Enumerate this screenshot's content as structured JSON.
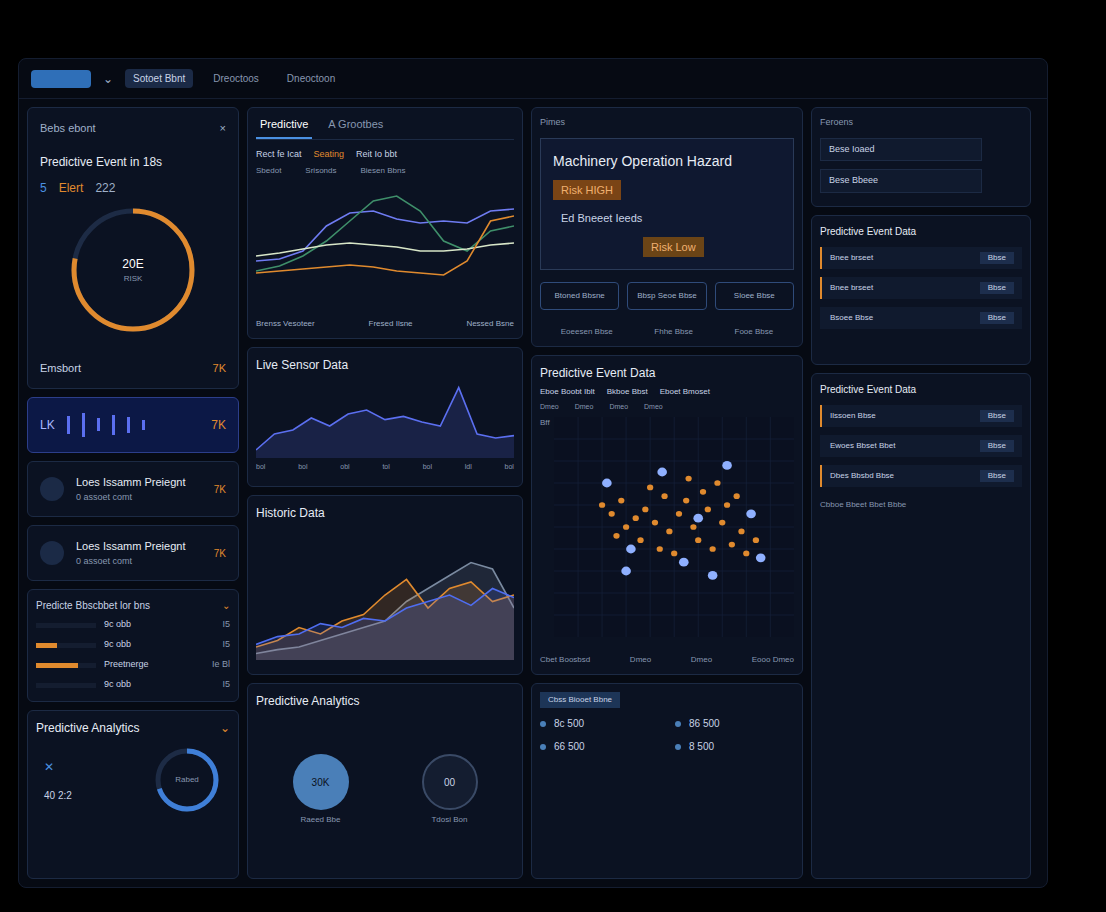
{
  "topbar": {
    "tabs": [
      {
        "label": "Sotoet Bbnt",
        "selected": true
      },
      {
        "label": "Dreoctoos",
        "selected": false
      },
      {
        "label": "Dneoctoon",
        "selected": false
      }
    ],
    "chevron": "⌄"
  },
  "event_card": {
    "title": "Bebs ebont",
    "close": "×",
    "heading": "Predictive Event in 18s",
    "stats": [
      "5",
      "Elert",
      "222"
    ],
    "gauge": {
      "value": "20E",
      "unit": "RISK",
      "level": 0.78
    },
    "footer": "Emsbort",
    "footer_badge": "7K"
  },
  "wave_strip": {
    "left": "LK",
    "right": "7K",
    "bars": [
      0.7,
      0.9,
      0.5,
      0.8,
      0.6,
      0.4
    ]
  },
  "alerts": [
    {
      "title": "Loes Issamm Preiegnt",
      "sub": "0 assoet comt",
      "badge": "7K"
    },
    {
      "title": "Loes Issamm Preiegnt",
      "sub": "0 assoet comt",
      "badge": "7K"
    }
  ],
  "list_card": {
    "title": "Predicte Bbscbbet lor bns",
    "chevron": "⌄",
    "rows": [
      {
        "label": "9c obb",
        "value": "I5",
        "level": 0.0
      },
      {
        "label": "9c obb",
        "value": "I5",
        "level": 0.35
      },
      {
        "label": "Preetnerge",
        "value": "Ie Bl",
        "level": 0.7
      },
      {
        "label": "9c obb",
        "value": "I5",
        "level": 0.0
      }
    ]
  },
  "left_analytics": {
    "title": "Predictive Analytics",
    "chevron": "⌄",
    "mark": "✕",
    "reading": "40 2:2",
    "knob_label": "Rabed",
    "level": 0.7
  },
  "predictive_chart": {
    "tabs": [
      {
        "label": "Predictive",
        "selected": true
      },
      {
        "label": "A Grootbes",
        "selected": false
      }
    ],
    "legend": [
      "Rect fe Icat",
      "Seating",
      "Reit Io bbt"
    ],
    "labels": [
      "Sbedot",
      "Srisonds",
      "Biesen Bbns"
    ],
    "footer": [
      "Brenss Vesoteer",
      "Fresed Ilsne",
      "Nessed Bsne"
    ],
    "series": [
      {
        "color": "#6f7cf2",
        "values": [
          20,
          22,
          30,
          55,
          68,
          70,
          62,
          58,
          60,
          58,
          70,
          72
        ]
      },
      {
        "color": "#3f8f6a",
        "values": [
          10,
          15,
          25,
          40,
          60,
          80,
          85,
          70,
          40,
          30,
          50,
          55
        ]
      },
      {
        "color": "#d8e6c8",
        "values": [
          25,
          28,
          32,
          36,
          38,
          36,
          34,
          30,
          30,
          32,
          36,
          38
        ]
      },
      {
        "color": "#e08a2e",
        "values": [
          8,
          10,
          12,
          14,
          16,
          14,
          10,
          8,
          6,
          20,
          60,
          65
        ]
      }
    ]
  },
  "live_sensor": {
    "title": "Live Sensor Data",
    "ticks": [
      "bol",
      "bol",
      "obl",
      "tol",
      "bol",
      "ldl",
      "bol"
    ],
    "series": [
      {
        "color": "#5b6ff0",
        "values": [
          10,
          30,
          35,
          50,
          40,
          55,
          60,
          48,
          52,
          45,
          40,
          88,
          30,
          25,
          28
        ]
      }
    ]
  },
  "historic": {
    "title": "Historic Data",
    "series": [
      {
        "color": "#7a8aa0",
        "values": [
          5,
          8,
          10,
          15,
          20,
          25,
          30,
          45,
          55,
          65,
          75,
          70,
          40
        ]
      },
      {
        "color": "#e08a2e",
        "values": [
          10,
          15,
          25,
          20,
          30,
          35,
          50,
          62,
          40,
          55,
          60,
          45,
          50
        ]
      },
      {
        "color": "#4f6df0",
        "values": [
          12,
          18,
          20,
          28,
          25,
          32,
          30,
          40,
          45,
          50,
          42,
          55,
          48
        ]
      }
    ]
  },
  "mid_analytics": {
    "title": "Predictive Analytics",
    "dials": [
      {
        "value": "30K",
        "caption": "Raeed Bbe"
      },
      {
        "value": "00",
        "caption": "Tdosi Bon"
      }
    ]
  },
  "hazard": {
    "label": "Pimes",
    "title": "Machinery Operation Hazard",
    "risks": [
      {
        "label": "Risk HIGH",
        "kind": "high"
      },
      {
        "label": "Ed Bneeet Ieeds",
        "kind": "plain"
      },
      {
        "label": "Risk Low",
        "kind": "low"
      }
    ],
    "buttons": [
      "Btoned Bbsne",
      "Bbsp Seoe Bbse",
      "Sloee Bbse"
    ],
    "footer": [
      "Eoeesen Bbse",
      "Fhhe Bbse",
      "Fooe Bbse"
    ]
  },
  "map": {
    "title": "Predictive Event Data",
    "filters": [
      "Eboe Boobt Iblt",
      "Bkboe Bbst",
      "Eboet Bmoset"
    ],
    "chips": [
      "Dmeo",
      "Dmeo",
      "Dmeo",
      "Dmeo"
    ],
    "axis": "Bff",
    "footer": [
      "Cbet Boosbsd",
      "Dmeo",
      "Dmeo",
      "Eooo Dmeo"
    ],
    "orange": [
      [
        20,
        40
      ],
      [
        24,
        44
      ],
      [
        28,
        38
      ],
      [
        30,
        50
      ],
      [
        34,
        46
      ],
      [
        38,
        42
      ],
      [
        42,
        48
      ],
      [
        46,
        36
      ],
      [
        48,
        52
      ],
      [
        52,
        44
      ],
      [
        55,
        38
      ],
      [
        58,
        50
      ],
      [
        60,
        56
      ],
      [
        64,
        42
      ],
      [
        66,
        60
      ],
      [
        70,
        48
      ],
      [
        72,
        40
      ],
      [
        74,
        58
      ],
      [
        78,
        52
      ],
      [
        80,
        62
      ],
      [
        36,
        56
      ],
      [
        44,
        60
      ],
      [
        50,
        62
      ],
      [
        26,
        54
      ],
      [
        62,
        34
      ],
      [
        68,
        30
      ],
      [
        76,
        36
      ],
      [
        84,
        56
      ],
      [
        40,
        32
      ],
      [
        56,
        28
      ]
    ],
    "blue": [
      [
        22,
        30
      ],
      [
        32,
        60
      ],
      [
        45,
        25
      ],
      [
        54,
        66
      ],
      [
        60,
        46
      ],
      [
        72,
        22
      ],
      [
        82,
        44
      ],
      [
        86,
        64
      ],
      [
        30,
        70
      ],
      [
        66,
        72
      ]
    ]
  },
  "stats": {
    "tag": "Cbss Biooet Bbne",
    "values": [
      "8c 500",
      "86 500",
      "66 500",
      "8 500"
    ]
  },
  "filters": {
    "title": "Feroens",
    "items": [
      "Bese Ioaed",
      "Bese Bbeee"
    ]
  },
  "event_table": {
    "title": "Predictive Event Data",
    "rows": [
      {
        "label": "Bnee brseet",
        "value": "Bbse",
        "highlight": true
      },
      {
        "label": "Bnee brseet",
        "value": "Bbse",
        "highlight": true
      },
      {
        "label": "Bsoee Bbse",
        "value": "Bbse",
        "highlight": false
      }
    ]
  },
  "event_table2": {
    "title": "Predictive Event Data",
    "rows": [
      {
        "label": "Ilssoen Bbse",
        "value": "Bbse",
        "highlight": true
      },
      {
        "label": "Ewoes Bbset Bbet",
        "value": "Bbse",
        "highlight": false
      },
      {
        "label": "Dbes Bbsbd Bbse",
        "value": "Bbse",
        "highlight": true
      }
    ],
    "footer": "Cbboe Bbeet Bbet Bbbe"
  }
}
